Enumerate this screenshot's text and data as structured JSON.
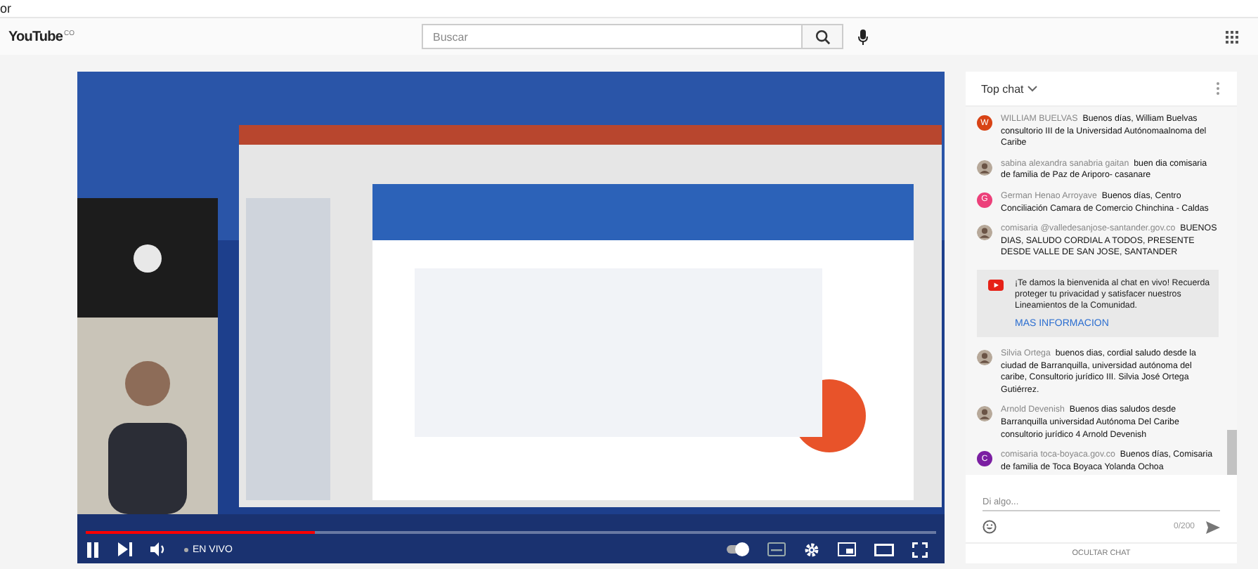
{
  "top_fragment": "or",
  "header": {
    "logo": "YouTube",
    "country": "CO",
    "search": {
      "placeholder": "Buscar"
    }
  },
  "player": {
    "progress": {
      "level": 0.27
    },
    "playing": true,
    "live_label": "EN VIVO",
    "autoplay": {
      "on": true
    }
  },
  "chat": {
    "title": "Top chat",
    "items": [
      {
        "kind": "message",
        "avatar": {
          "kind": "letter",
          "letter": "W",
          "color": "#d84315"
        },
        "author": "WILLIAM BUELVAS",
        "text": "Buenos días, William Buelvas consultorio III de la Universidad Autónomaalnoma del Caribe"
      },
      {
        "kind": "message",
        "author": "sabina alexandra sanabria gaitan",
        "text": "buen dia comisaria de familia de Paz de Ariporo- casanare"
      },
      {
        "kind": "message",
        "avatar": {
          "kind": "letter",
          "letter": "G",
          "color": "#ec407a"
        },
        "author": "German Henao Arroyave",
        "text": "Buenos días, Centro Conciliación Camara de Comercio Chinchina - Caldas"
      },
      {
        "kind": "message",
        "author": "comisaria @valledesanjose-santander.gov.co",
        "text": "BUENOS DIAS, SALUDO CORDIAL A TODOS, PRESENTE DESDE VALLE DE SAN JOSE, SANTANDER"
      },
      {
        "kind": "notice",
        "text": "¡Te damos la bienvenida al chat en vivo! Recuerda proteger tu privacidad y satisfacer nuestros Lineamientos de la Comunidad.",
        "link": "MAS INFORMACION"
      },
      {
        "kind": "message",
        "author": "Silvia Ortega",
        "text": "buenos dias, cordial saludo desde la ciudad de Barranquilla, universidad autónoma del caribe, Consultorio jurídico III. Silvia José Ortega Gutiérrez."
      },
      {
        "kind": "message",
        "author": "Arnold Devenish",
        "text": "Buenos dias saludos desde Barranquilla universidad Autónoma Del Caribe consultorio jurídico 4 Arnold Devenish"
      },
      {
        "kind": "message",
        "avatar": {
          "kind": "letter",
          "letter": "C",
          "color": "#7b1fa2"
        },
        "author": "comisaria toca-boyaca.gov.co",
        "text": "Buenos días, Comisaria de familia de Toca Boyaca Yolanda Ochoa"
      }
    ],
    "input": {
      "placeholder": "Di algo...",
      "counter": "0/200"
    },
    "hide_button": "OCULTAR CHAT"
  }
}
